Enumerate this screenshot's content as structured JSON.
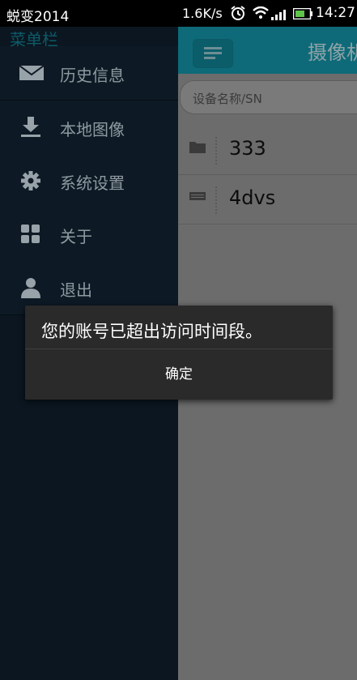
{
  "status_bar": {
    "carrier": "蜕变2014",
    "net_speed": "1.6K/s",
    "time": "14:27"
  },
  "drawer": {
    "title": "菜单栏",
    "items": [
      {
        "label": "历史信息",
        "icon": "mail-icon"
      },
      {
        "label": "本地图像",
        "icon": "download-icon"
      },
      {
        "label": "系统设置",
        "icon": "gear-icon"
      },
      {
        "label": "关于",
        "icon": "grid-icon"
      },
      {
        "label": "退出",
        "icon": "person-icon"
      }
    ]
  },
  "main": {
    "header_title": "摄像机",
    "search_placeholder": "设备名称/SN",
    "devices": [
      {
        "name": "333",
        "icon": "folder-icon"
      },
      {
        "name": "4dvs",
        "icon": "dvr-icon"
      }
    ]
  },
  "dialog": {
    "message": "您的账号已超出访问时间段。",
    "ok_label": "确定"
  }
}
